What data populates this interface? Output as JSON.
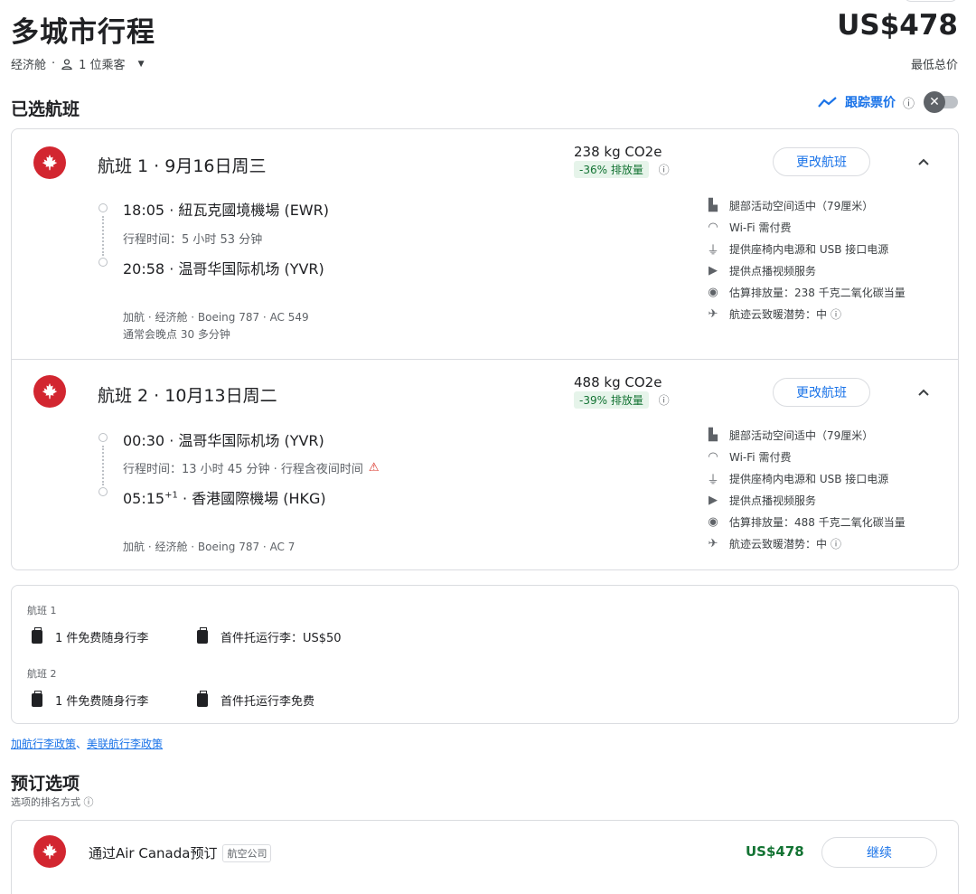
{
  "header": {
    "title": "多城市行程",
    "price": "US$478",
    "cabin": "经济舱",
    "separator": "·",
    "passengers": "1 位乘客",
    "lowest_label": "最低总价"
  },
  "selected": {
    "title": "已选航班",
    "track_label": "跟踪票价"
  },
  "flights": [
    {
      "title": "航班 1 · 9月16日周三",
      "co2": "238 kg CO2e",
      "co2_badge": "-36% 排放量",
      "change_label": "更改航班",
      "dep": "18:05 · 紐瓦克國境機場 (EWR)",
      "duration": "行程时间：5 小时 53 分钟",
      "arr": "20:58 · 温哥华国际机场 (YVR)",
      "details": "加航 · 经济舱 · Boeing 787 · AC 549",
      "delay": "通常会晚点 30 多分钟",
      "amenities": [
        "腿部活动空间适中（79厘米）",
        "Wi-Fi 需付费",
        "提供座椅内电源和 USB 接口电源",
        "提供点播视频服务",
        "估算排放量：238 千克二氧化碳当量",
        "航迹云致暖潜势：中"
      ]
    },
    {
      "title": "航班 2 · 10月13日周二",
      "co2": "488 kg CO2e",
      "co2_badge": "-39% 排放量",
      "change_label": "更改航班",
      "dep": "00:30 · 温哥华国际机场 (YVR)",
      "duration": "行程时间：13 小时 45 分钟 · 行程含夜间时间",
      "arr_time": "05:15",
      "arr_sup": "+1",
      "arr_place": " · 香港國際機場 (HKG)",
      "details": "加航 · 经济舱 · Boeing 787 · AC 7",
      "amenities": [
        "腿部活动空间适中（79厘米）",
        "Wi-Fi 需付费",
        "提供座椅内电源和 USB 接口电源",
        "提供点播视频服务",
        "估算排放量：488 千克二氧化碳当量",
        "航迹云致暖潜势：中"
      ]
    }
  ],
  "baggage": [
    {
      "label": "航班 1",
      "carry": "1 件免费随身行李",
      "checked": "首件托运行李：US$50"
    },
    {
      "label": "航班 2",
      "carry": "1 件免费随身行李",
      "checked": "首件托运行李免费"
    }
  ],
  "policy_links": {
    "first": "加航行李政策",
    "sep": "、",
    "second": "美联航行李政策"
  },
  "booking": {
    "title": "预订选项",
    "subtitle": "选项的排名方式",
    "option_name": "通过Air Canada预订",
    "option_tag": "航空公司",
    "option_price": "US$478",
    "continue_label": "继续"
  },
  "colors": {
    "accent": "#1a73e8",
    "brand_red": "#d22630",
    "price_green": "#137333"
  },
  "icons": [
    "person-icon",
    "trend-icon",
    "info-icon",
    "close-icon",
    "maple-leaf-icon",
    "chevron-up-icon",
    "legroom-icon",
    "wifi-icon",
    "power-icon",
    "video-icon",
    "globe-icon",
    "contrail-icon",
    "warning-icon",
    "bag-icon"
  ]
}
